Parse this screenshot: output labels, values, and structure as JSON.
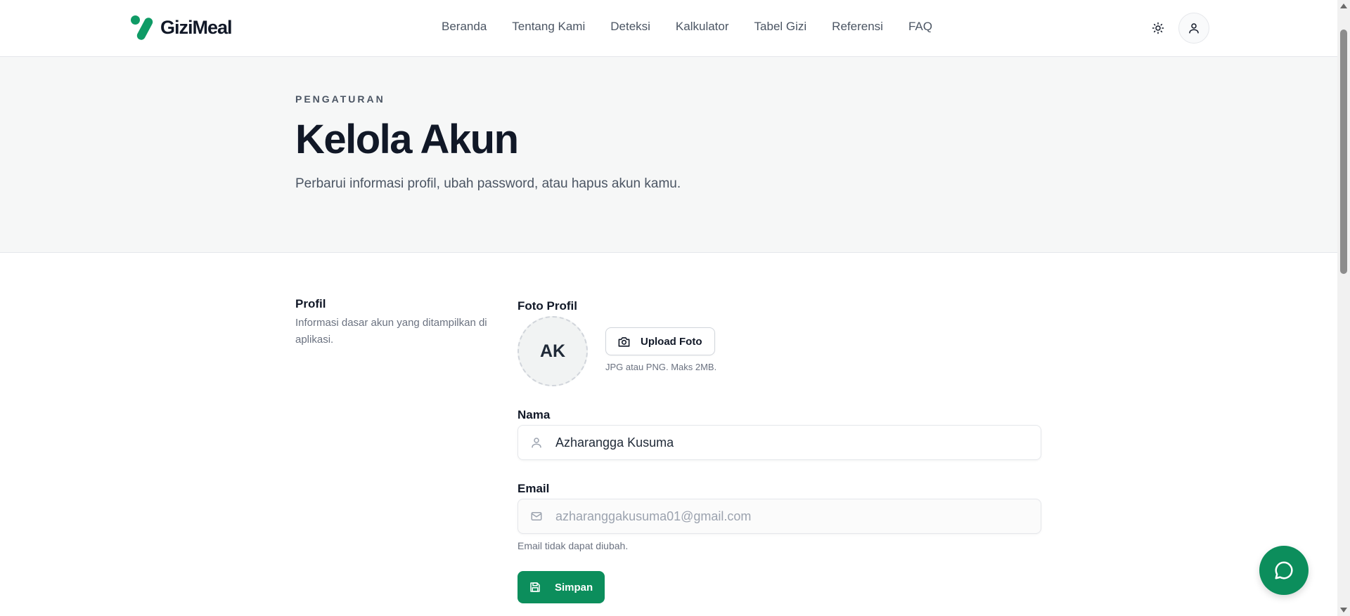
{
  "brand": {
    "name": "GiziMeal",
    "color": "#0f9b66"
  },
  "nav": {
    "items": [
      {
        "label": "Beranda"
      },
      {
        "label": "Tentang Kami"
      },
      {
        "label": "Deteksi"
      },
      {
        "label": "Kalkulator"
      },
      {
        "label": "Tabel Gizi"
      },
      {
        "label": "Referensi"
      },
      {
        "label": "FAQ"
      }
    ],
    "theme_icon": "sun-icon",
    "account_icon": "user-icon"
  },
  "hero": {
    "eyebrow": "PENGATURAN",
    "title": "Kelola Akun",
    "subtitle": "Perbarui informasi profil, ubah password, atau hapus akun kamu."
  },
  "profile": {
    "section_title": "Profil",
    "section_desc": "Informasi dasar akun yang ditampilkan di aplikasi.",
    "photo_label": "Foto Profil",
    "avatar_initials": "AK",
    "upload_label": "Upload Foto",
    "upload_icon": "camera-icon",
    "upload_hint": "JPG atau PNG. Maks 2MB.",
    "name_label": "Nama",
    "name_value": "Azharangga Kusuma",
    "name_icon": "user-icon",
    "email_label": "Email",
    "email_value": "azharanggakusuma01@gmail.com",
    "email_icon": "mail-icon",
    "email_note": "Email tidak dapat diubah.",
    "save_label": "Simpan",
    "save_icon": "save-icon",
    "accent": "#0c8e5c"
  },
  "chat": {
    "icon": "chat-bubble-icon"
  }
}
